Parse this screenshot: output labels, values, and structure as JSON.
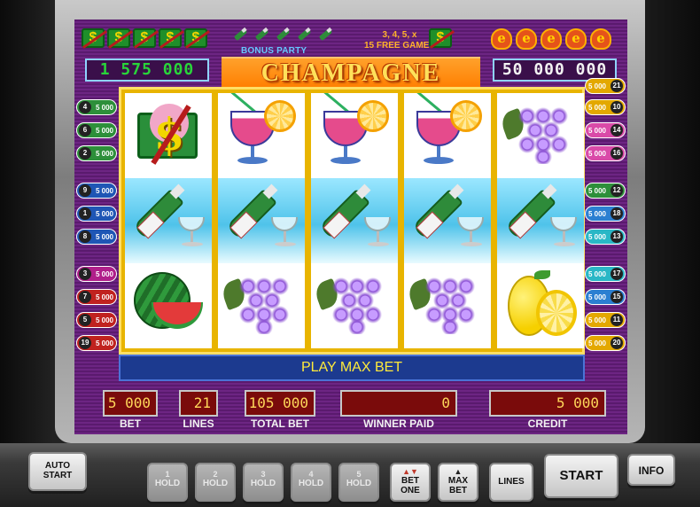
{
  "colors": {
    "screen_bg": "#6d2583",
    "reel_frame": "#e8b400",
    "meter_bg": "#7a0b0b",
    "meter_text": "#ffd75a",
    "message_bg": "#1c3a8f",
    "message_text": "#ffea3a",
    "jackpot_left_text": "#29d43a"
  },
  "header": {
    "bonus_party": "BONUS PARTY",
    "free_games_line1": "3, 4, 5, x",
    "free_games_line2": "15 FREE GAMES",
    "title": "CHAMPAGNE",
    "jackpot_left": "1 575 000",
    "jackpot_right": "50 000 000",
    "scatter_symbol": "$",
    "e_symbol": "e"
  },
  "reels": [
    [
      "dollar-scatter",
      "champagne-bottle",
      "watermelon"
    ],
    [
      "cocktail",
      "champagne-bottle",
      "grapes"
    ],
    [
      "cocktail",
      "champagne-bottle",
      "grapes"
    ],
    [
      "cocktail",
      "champagne-bottle",
      "grapes"
    ],
    [
      "grapes",
      "champagne-bottle",
      "lemon"
    ]
  ],
  "lines_left": [
    {
      "num": "4",
      "amount": "5 000",
      "color": "#2d8f3a"
    },
    {
      "num": "6",
      "amount": "5 000",
      "color": "#2d8f3a"
    },
    {
      "num": "2",
      "amount": "5 000",
      "color": "#2d8f3a"
    },
    {
      "num": "9",
      "amount": "5 000",
      "color": "#1f56b5"
    },
    {
      "num": "1",
      "amount": "5 000",
      "color": "#1f56b5"
    },
    {
      "num": "8",
      "amount": "5 000",
      "color": "#1f56b5"
    },
    {
      "num": "3",
      "amount": "5 000",
      "color": "#b01f8a"
    },
    {
      "num": "7",
      "amount": "5 000",
      "color": "#c0221f"
    },
    {
      "num": "5",
      "amount": "5 000",
      "color": "#c0221f"
    },
    {
      "num": "19",
      "amount": "5 000",
      "color": "#c0221f"
    }
  ],
  "lines_right": [
    {
      "num": "21",
      "amount": "5 000",
      "color": "#e3a800"
    },
    {
      "num": "10",
      "amount": "5 000",
      "color": "#e3a800"
    },
    {
      "num": "14",
      "amount": "5 000",
      "color": "#d94aa8"
    },
    {
      "num": "16",
      "amount": "5 000",
      "color": "#d94aa8"
    },
    {
      "num": "12",
      "amount": "5 000",
      "color": "#2d8f3a"
    },
    {
      "num": "18",
      "amount": "5 000",
      "color": "#2b7fd1"
    },
    {
      "num": "13",
      "amount": "5 000",
      "color": "#2ab7c6"
    },
    {
      "num": "17",
      "amount": "5 000",
      "color": "#2ab7c6"
    },
    {
      "num": "15",
      "amount": "5 000",
      "color": "#2b7fd1"
    },
    {
      "num": "11",
      "amount": "5 000",
      "color": "#e3a800"
    },
    {
      "num": "20",
      "amount": "5 000",
      "color": "#e3a800"
    }
  ],
  "message": "PLAY MAX BET",
  "meters": {
    "bet": {
      "label": "BET",
      "value": "5 000"
    },
    "lines": {
      "label": "LINES",
      "value": "21"
    },
    "total_bet": {
      "label": "TOTAL BET",
      "value": "105 000"
    },
    "winner_paid": {
      "label": "WINNER PAID",
      "value": "0"
    },
    "credit": {
      "label": "CREDIT",
      "value": "5 000"
    }
  },
  "buttons": {
    "auto_start": "AUTO START",
    "hold_label": "HOLD",
    "holds": [
      "1",
      "2",
      "3",
      "4",
      "5"
    ],
    "bet_one": "BET ONE",
    "max_bet": "MAX BET",
    "lines": "LINES",
    "start": "START",
    "info": "INFO"
  }
}
